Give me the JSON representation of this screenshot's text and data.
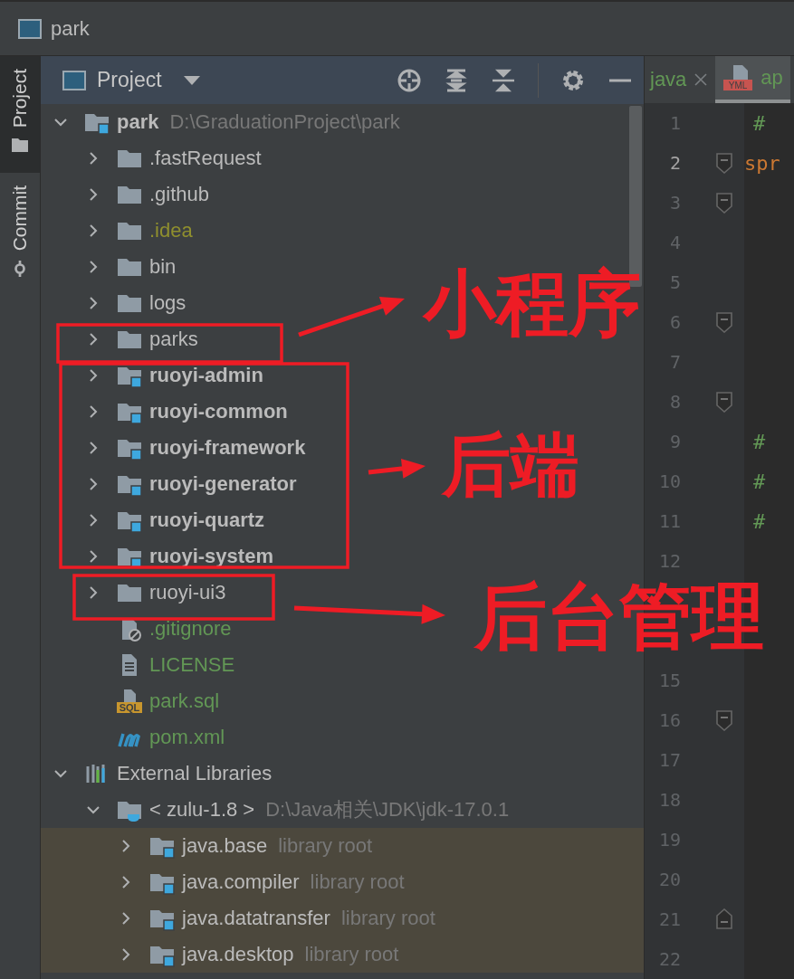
{
  "window": {
    "title": "park"
  },
  "tool_stripe": [
    {
      "label": "Project",
      "kind": "project",
      "selected": true
    },
    {
      "label": "Commit",
      "kind": "commit",
      "selected": false
    }
  ],
  "project_panel": {
    "title": "Project"
  },
  "tree": [
    {
      "name": "park",
      "kind": "module",
      "hint": "D:\\GraduationProject\\park",
      "expanded": true,
      "color": "#bbbbbb",
      "children": [
        {
          "name": ".fastRequest",
          "kind": "folder",
          "expanded": false,
          "color": "#bbbbbb"
        },
        {
          "name": ".github",
          "kind": "folder",
          "expanded": false,
          "color": "#bbbbbb"
        },
        {
          "name": ".idea",
          "kind": "folder",
          "expanded": false,
          "color": "#8f8f2e"
        },
        {
          "name": "bin",
          "kind": "folder",
          "expanded": false,
          "color": "#bbbbbb"
        },
        {
          "name": "logs",
          "kind": "folder",
          "expanded": false,
          "color": "#bbbbbb"
        },
        {
          "name": "parks",
          "kind": "folder",
          "expanded": false,
          "color": "#bbbbbb"
        },
        {
          "name": "ruoyi-admin",
          "kind": "module",
          "expanded": false,
          "color": "#bbbbbb"
        },
        {
          "name": "ruoyi-common",
          "kind": "module",
          "expanded": false,
          "color": "#bbbbbb"
        },
        {
          "name": "ruoyi-framework",
          "kind": "module",
          "expanded": false,
          "color": "#bbbbbb"
        },
        {
          "name": "ruoyi-generator",
          "kind": "module",
          "expanded": false,
          "color": "#bbbbbb"
        },
        {
          "name": "ruoyi-quartz",
          "kind": "module",
          "expanded": false,
          "color": "#bbbbbb"
        },
        {
          "name": "ruoyi-system",
          "kind": "module",
          "expanded": false,
          "color": "#bbbbbb"
        },
        {
          "name": "ruoyi-ui3",
          "kind": "folder",
          "expanded": false,
          "color": "#bbbbbb"
        },
        {
          "name": ".gitignore",
          "kind": "ignore-file",
          "color": "#629755"
        },
        {
          "name": "LICENSE",
          "kind": "text-file",
          "color": "#629755"
        },
        {
          "name": "park.sql",
          "kind": "sql-file",
          "icon_label": "SQL",
          "color": "#629755"
        },
        {
          "name": "pom.xml",
          "kind": "maven-file",
          "color": "#629755"
        }
      ]
    },
    {
      "name": "External Libraries",
      "kind": "libraries",
      "expanded": true,
      "color": "#bbbbbb",
      "children": [
        {
          "name": "< zulu-1.8 >",
          "kind": "jdk",
          "hint": "D:\\Java相关\\JDK\\jdk-17.0.1",
          "expanded": true,
          "color": "#bbbbbb",
          "children": [
            {
              "name": "java.base",
              "kind": "library-root",
              "hint": "library root",
              "expanded": false,
              "color": "#bbbbbb"
            },
            {
              "name": "java.compiler",
              "kind": "library-root",
              "hint": "library root",
              "expanded": false,
              "color": "#bbbbbb"
            },
            {
              "name": "java.datatransfer",
              "kind": "library-root",
              "hint": "library root",
              "expanded": false,
              "color": "#bbbbbb"
            },
            {
              "name": "java.desktop",
              "kind": "library-root",
              "hint": "library root",
              "expanded": false,
              "color": "#bbbbbb"
            }
          ]
        }
      ]
    }
  ],
  "editor": {
    "tabs": [
      {
        "label": "java",
        "selected": false
      },
      {
        "label": "ap",
        "icon_label": "YML",
        "selected": true
      }
    ],
    "lines_upper": [
      {
        "number": "1",
        "text": "#",
        "kind": "comment"
      },
      {
        "number": "2",
        "text": "spr",
        "kind": "key",
        "fold": true,
        "current": true
      },
      {
        "number": "3",
        "fold": true
      },
      {
        "number": "4"
      },
      {
        "number": "5"
      },
      {
        "number": "6",
        "fold": true
      },
      {
        "number": "7"
      },
      {
        "number": "8",
        "fold": true
      },
      {
        "number": "9",
        "text": "#",
        "kind": "comment"
      },
      {
        "number": "10",
        "text": "#",
        "kind": "comment"
      },
      {
        "number": "11",
        "text": "#",
        "kind": "comment"
      },
      {
        "number": "12"
      }
    ],
    "lines_lower": [
      {
        "number": "15"
      },
      {
        "number": "16",
        "fold": true
      },
      {
        "number": "17"
      },
      {
        "number": "18"
      },
      {
        "number": "19"
      },
      {
        "number": "20"
      },
      {
        "number": "21",
        "fold_end": true
      },
      {
        "number": "22"
      }
    ]
  },
  "annotations": [
    {
      "text": "小程序"
    },
    {
      "text": "后端"
    },
    {
      "text": "后台管理"
    }
  ]
}
